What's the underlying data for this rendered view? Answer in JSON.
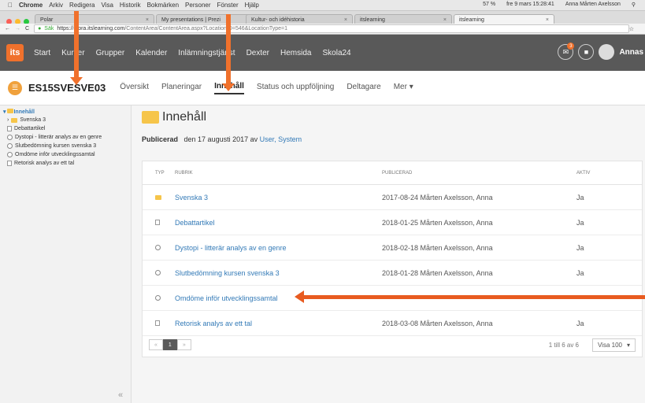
{
  "menubar": {
    "apple": "",
    "items": [
      "Chrome",
      "Arkiv",
      "Redigera",
      "Visa",
      "Historik",
      "Bokmärken",
      "Personer",
      "Fönster",
      "Hjälp"
    ],
    "status": [
      "57 %",
      "fre 9 mars 15:28:41",
      "Anna Mårten Axelsson"
    ]
  },
  "tabs": [
    {
      "label": "Polar"
    },
    {
      "label": "My presentations | Prezi"
    },
    {
      "label": "Kultur- och idéhistoria"
    },
    {
      "label": "itslearning"
    },
    {
      "label": "itslearning"
    }
  ],
  "address": {
    "secure": "Säk",
    "host": "https://mora.itslearning.com",
    "path": "/ContentArea/ContentArea.aspx?LocationID=546&LocationType=1"
  },
  "appnav": {
    "logo": "its",
    "items": [
      "Start",
      "Kurser",
      "Grupper",
      "Kalender",
      "Inlämningstjänst",
      "Dexter",
      "Hemsida",
      "Skola24"
    ],
    "badge": "3",
    "user": "Annas"
  },
  "course": {
    "code": "ES15SVESVE03",
    "tabs": [
      "Översikt",
      "Planeringar",
      "Innehåll",
      "Status och uppföljning",
      "Deltagare",
      "Mer"
    ],
    "active_tab": "Innehåll"
  },
  "sidebar": {
    "root": "Innehåll",
    "items": [
      {
        "label": "Svenska 3",
        "type": "folder"
      },
      {
        "label": "Debattartikel",
        "type": "doc"
      },
      {
        "label": "Dystopi - litterär analys av en genre",
        "type": "task"
      },
      {
        "label": "Slutbedömning kursen svenska 3",
        "type": "task"
      },
      {
        "label": "Omdöme inför utvecklingssamtal",
        "type": "task"
      },
      {
        "label": "Retorisk analys av ett tal",
        "type": "doc"
      }
    ],
    "collapse": "«"
  },
  "main": {
    "title": "Innehåll",
    "published_label": "Publicerad",
    "published_text": "den 17 augusti 2017 av",
    "published_by": "User, System",
    "columns": [
      "TYP",
      "RUBRIK",
      "PUBLICERAD",
      "AKTIV"
    ],
    "rows": [
      {
        "type": "folder",
        "title": "Svenska 3",
        "published": "2017-08-24 Mårten Axelsson, Anna",
        "active": "Ja"
      },
      {
        "type": "doc",
        "title": "Debattartikel",
        "published": "2018-01-25 Mårten Axelsson, Anna",
        "active": "Ja"
      },
      {
        "type": "task",
        "title": "Dystopi - litterär analys av en genre",
        "published": "2018-02-18 Mårten Axelsson, Anna",
        "active": "Ja"
      },
      {
        "type": "task",
        "title": "Slutbedömning kursen svenska 3",
        "published": "2018-01-28 Mårten Axelsson, Anna",
        "active": "Ja"
      },
      {
        "type": "task",
        "title": "Omdöme inför utvecklingssamtal",
        "published": "",
        "active": ""
      },
      {
        "type": "doc",
        "title": "Retorisk analys av ett tal",
        "published": "2018-03-08 Mårten Axelsson, Anna",
        "active": "Ja"
      }
    ],
    "pager": {
      "prev": "«",
      "page": "1",
      "next": "»"
    },
    "count": "1 till 6 av 6",
    "show": "Visa 100"
  },
  "colors": {
    "nav": "#595959",
    "accent": "#f0712c",
    "link": "#337ab7"
  }
}
